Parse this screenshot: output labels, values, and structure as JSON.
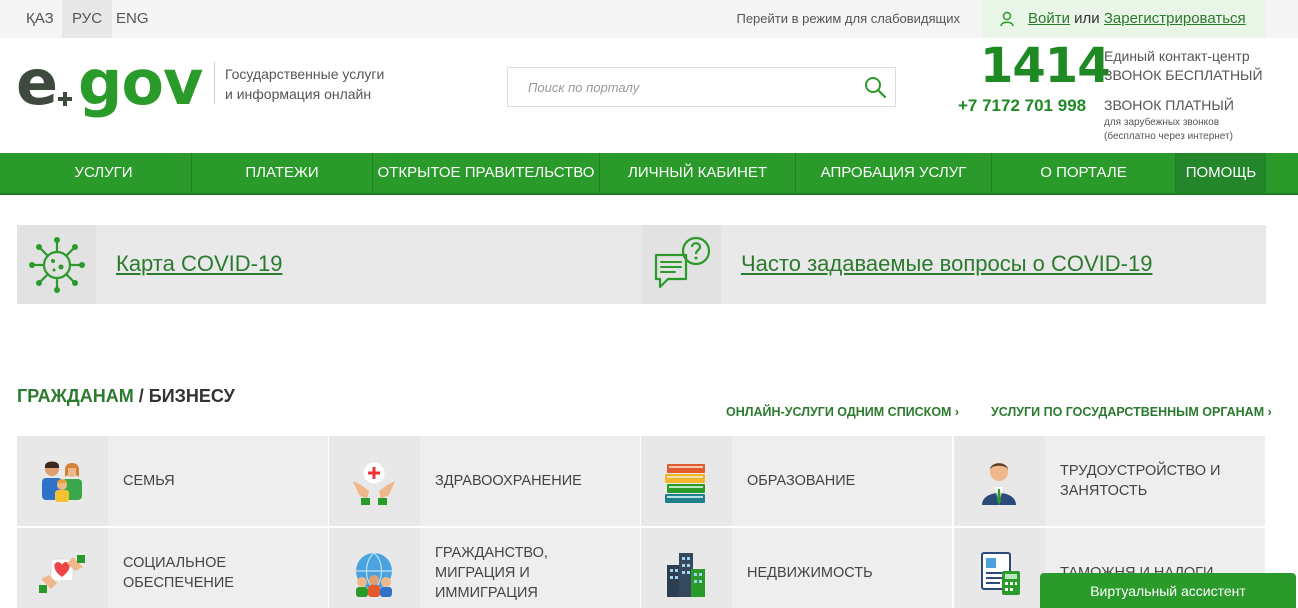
{
  "languages": [
    {
      "label": "ҚАЗ",
      "active": false
    },
    {
      "label": "РУС",
      "active": true
    },
    {
      "label": "ENG",
      "active": false
    }
  ],
  "accessibility_link": "Перейти в режим для слабовидящих",
  "auth": {
    "login": "Войти",
    "or": "или",
    "register": "Зарегистрироваться"
  },
  "logo": {
    "e": "e",
    "gov": "gov"
  },
  "tagline": {
    "line1": "Государственные услуги",
    "line2": "и информация онлайн"
  },
  "search": {
    "placeholder": "Поиск по порталу"
  },
  "contacts": {
    "short_number": "1414",
    "long_number": "+7 7172 701 998",
    "center": "Единый контакт-центр",
    "free": "ЗВОНОК БЕСПЛАТНЫЙ",
    "paid": "ЗВОНОК ПЛАТНЫЙ",
    "foreign1": "для зарубежных звонков",
    "foreign2": "(бесплатно через интернет)"
  },
  "nav": [
    {
      "label": "УСЛУГИ"
    },
    {
      "label": "ПЛАТЕЖИ"
    },
    {
      "label": "ОТКРЫТОЕ ПРАВИТЕЛЬСТВО"
    },
    {
      "label": "ЛИЧНЫЙ КАБИНЕТ"
    },
    {
      "label": "АПРОБАЦИЯ УСЛУГ"
    },
    {
      "label": "О ПОРТАЛЕ"
    },
    {
      "label": "ПОМОЩЬ"
    }
  ],
  "banners": {
    "map": "Карта COVID-19",
    "faq": "Часто задаваемые вопросы о COVID-19"
  },
  "section": {
    "title_citizens": "ГРАЖДАНАМ",
    "separator": "/",
    "title_business": "БИЗНЕСУ",
    "link_online": "ОНЛАЙН-УСЛУГИ ОДНИМ СПИСКОМ ›",
    "link_agency": "УСЛУГИ ПО ГОСУДАРСТВЕННЫМ ОРГАНАМ ›"
  },
  "tiles": [
    {
      "label": "Семья",
      "icon": "family-icon"
    },
    {
      "label": "Здравоохранение",
      "icon": "healthcare-icon"
    },
    {
      "label": "Образование",
      "icon": "books-icon"
    },
    {
      "label": "Трудоустройство и занятость",
      "icon": "employee-icon"
    },
    {
      "label": "Социальное обеспечение",
      "icon": "social-care-icon"
    },
    {
      "label": "Гражданство, миграция и иммиграция",
      "icon": "globe-people-icon"
    },
    {
      "label": "Недвижимость",
      "icon": "buildings-icon"
    },
    {
      "label": "Таможня и налоги",
      "icon": "customs-icon"
    }
  ],
  "assistant": "Виртуальный ассистент",
  "colors": {
    "brand_green": "#2a9a2a",
    "text_green": "#2b7a2e",
    "dark": "#3d4a3d"
  }
}
